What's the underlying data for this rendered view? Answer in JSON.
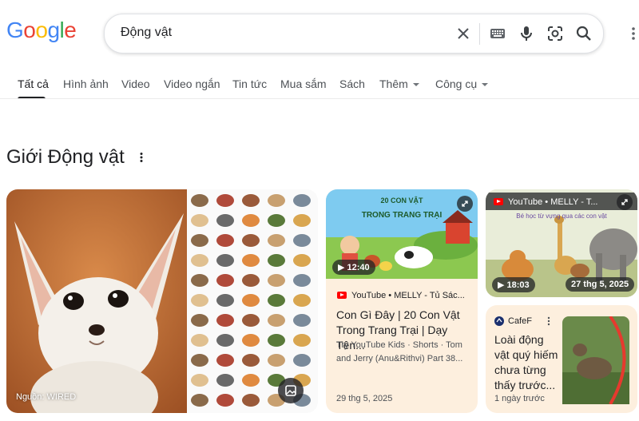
{
  "logo": {
    "letters": [
      "G",
      "o",
      "o",
      "g",
      "l",
      "e"
    ],
    "colors": [
      "#4285F4",
      "#EA4335",
      "#FBBC05",
      "#4285F4",
      "#34A853",
      "#EA4335"
    ]
  },
  "search": {
    "query": "Động vật"
  },
  "tabs": [
    {
      "label": "Tất cả",
      "active": true
    },
    {
      "label": "Hình ảnh"
    },
    {
      "label": "Video"
    },
    {
      "label": "Video ngắn"
    },
    {
      "label": "Tin tức"
    },
    {
      "label": "Mua sắm"
    },
    {
      "label": "Sách"
    },
    {
      "label": "Thêm"
    },
    {
      "label": "Công cụ"
    }
  ],
  "section": {
    "title": "Giới Động vật"
  },
  "fox_image": {
    "source": "Nguồn: WIRED"
  },
  "card1": {
    "thumb_text_line1": "20 CON VẬT",
    "thumb_text_line2": "TRONG TRANG TRẠI",
    "duration": "12:40",
    "source": "YouTube • MELLY - Tủ Sác...",
    "title": "Con Gì Đây | 20 Con Vật Trong Trang Trại | Dạy Tên...",
    "subtitle": "Try YouTube Kids · Shorts · Tom and Jerry (Anu&Rithvi) Part 38...",
    "date": "29 thg 5, 2025"
  },
  "card2": {
    "source": "YouTube • MELLY - T...",
    "thumb_caption": "Bé học từ vựng qua các con vật",
    "duration": "18:03",
    "date": "27 thg 5, 2025"
  },
  "card3": {
    "source": "CafeF",
    "title": "Loài động vật quý hiếm chưa từng thấy trước...",
    "date": "1 ngày trước"
  },
  "icons": [
    "clear-icon",
    "keyboard-icon",
    "mic-icon",
    "lens-icon",
    "search-icon",
    "more-vert-icon",
    "expand-icon",
    "play-icon",
    "image-search-icon"
  ]
}
